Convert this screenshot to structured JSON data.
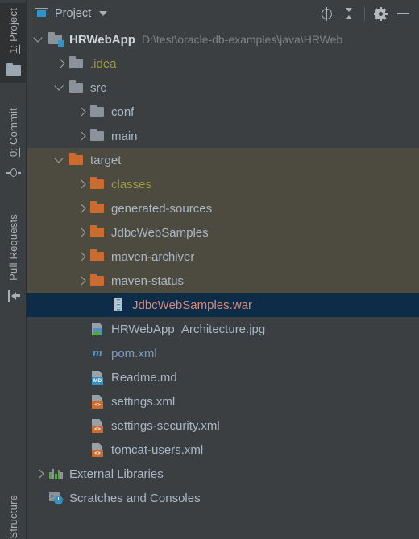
{
  "tool_stripe": {
    "tabs": [
      {
        "label": "1: Project",
        "icon": "folder-icon",
        "active": true
      },
      {
        "label": "0: Commit",
        "icon": "commit-icon",
        "active": false
      },
      {
        "label": "Pull Requests",
        "icon": "pull-request-icon",
        "active": false
      }
    ],
    "bottom_tabs": [
      {
        "label": "Structure",
        "active": false
      }
    ]
  },
  "header": {
    "title": "Project",
    "view_icon": "project-view-icon",
    "dropdown_icon": "chevron-down-icon",
    "actions": [
      {
        "name": "select-opened-file-button",
        "icon": "locate-crosshair-icon"
      },
      {
        "name": "collapse-all-button",
        "icon": "collapse-all-icon"
      },
      {
        "name": "options-button",
        "icon": "gear-icon"
      },
      {
        "name": "hide-button",
        "icon": "minus-icon"
      }
    ]
  },
  "tree": {
    "nodes": [
      {
        "label": "HRWebApp",
        "path": "D:\\test\\oracle-db-examples\\java\\HRWeb",
        "depth": 0,
        "twisty": "down",
        "icon": "module-folder-icon",
        "style": "module"
      },
      {
        "label": ".idea",
        "path": "",
        "depth": 1,
        "twisty": "right",
        "icon": "folder-gray-icon",
        "style": "excluded-text"
      },
      {
        "label": "src",
        "path": "",
        "depth": 1,
        "twisty": "down",
        "icon": "folder-gray-icon",
        "style": "normal"
      },
      {
        "label": "conf",
        "path": "",
        "depth": 2,
        "twisty": "right",
        "icon": "folder-gray-icon",
        "style": "normal"
      },
      {
        "label": "main",
        "path": "",
        "depth": 2,
        "twisty": "right",
        "icon": "folder-gray-icon",
        "style": "normal"
      },
      {
        "label": "target",
        "path": "",
        "depth": 1,
        "twisty": "down",
        "icon": "folder-orange-icon",
        "style": "excluded-row"
      },
      {
        "label": "classes",
        "path": "",
        "depth": 2,
        "twisty": "right",
        "icon": "folder-orange-icon",
        "style": "excluded-row-text"
      },
      {
        "label": "generated-sources",
        "path": "",
        "depth": 2,
        "twisty": "right",
        "icon": "folder-orange-icon",
        "style": "excluded-row"
      },
      {
        "label": "JdbcWebSamples",
        "path": "",
        "depth": 2,
        "twisty": "right",
        "icon": "folder-orange-icon",
        "style": "excluded-row"
      },
      {
        "label": "maven-archiver",
        "path": "",
        "depth": 2,
        "twisty": "right",
        "icon": "folder-orange-icon",
        "style": "excluded-row"
      },
      {
        "label": "maven-status",
        "path": "",
        "depth": 2,
        "twisty": "right",
        "icon": "folder-orange-icon",
        "style": "excluded-row"
      },
      {
        "label": "JdbcWebSamples.war",
        "path": "",
        "depth": 3,
        "twisty": "none",
        "icon": "war-archive-icon",
        "style": "selected"
      },
      {
        "label": "HRWebApp_Architecture.jpg",
        "path": "",
        "depth": 2,
        "twisty": "none",
        "icon": "image-file-icon",
        "style": "normal"
      },
      {
        "label": "pom.xml",
        "path": "",
        "depth": 2,
        "twisty": "none",
        "icon": "maven-file-icon",
        "style": "maven"
      },
      {
        "label": "Readme.md",
        "path": "",
        "depth": 2,
        "twisty": "none",
        "icon": "markdown-file-icon",
        "style": "normal"
      },
      {
        "label": "settings.xml",
        "path": "",
        "depth": 2,
        "twisty": "none",
        "icon": "xml-file-icon",
        "style": "normal"
      },
      {
        "label": "settings-security.xml",
        "path": "",
        "depth": 2,
        "twisty": "none",
        "icon": "xml-file-icon",
        "style": "normal"
      },
      {
        "label": "tomcat-users.xml",
        "path": "",
        "depth": 2,
        "twisty": "none",
        "icon": "xml-file-icon",
        "style": "normal"
      },
      {
        "label": "External Libraries",
        "path": "",
        "depth": 0,
        "twisty": "right",
        "icon": "libraries-bars-icon",
        "style": "normal"
      },
      {
        "label": "Scratches and Consoles",
        "path": "",
        "depth": 0,
        "twisty": "none",
        "icon": "scratches-icon",
        "style": "normal"
      }
    ]
  },
  "colors": {
    "panel_bg": "#3c3f41",
    "selection_bg": "#0d2c47",
    "excluded_bg": "#4d4a3f",
    "excluded_text": "#9c9b3f",
    "text": "#a9b7c6",
    "muted_text": "#7f8285",
    "accent_blue": "#3592c4",
    "folder_orange": "#cc6b30",
    "war_text": "#d98a7e"
  }
}
